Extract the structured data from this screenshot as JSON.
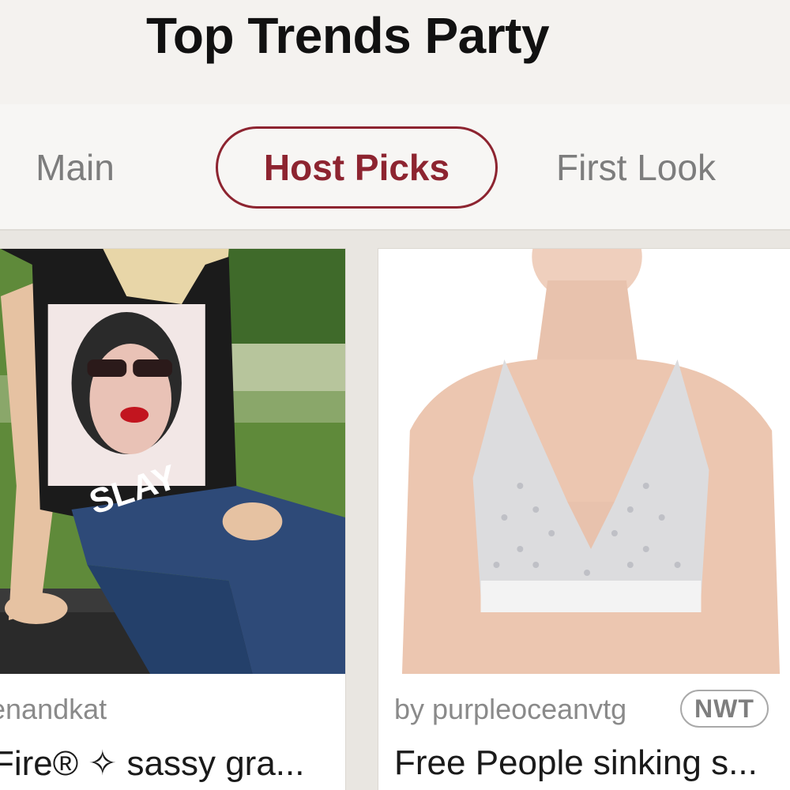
{
  "header": {
    "title": "Top Trends Party"
  },
  "tabs": [
    {
      "label": "Main",
      "active": false
    },
    {
      "label": "Host Picks",
      "active": true
    },
    {
      "label": "First Look",
      "active": false
    }
  ],
  "colors": {
    "accent": "#8d2430",
    "muted_text": "#7d7d7d",
    "background": "#eceae6"
  },
  "listings": [
    {
      "seller": "enandkat",
      "title": "Fire® ✧ sassy gra...",
      "shirt_text": "SLAY"
    },
    {
      "seller": "by purpleoceanvtg",
      "badge": "NWT",
      "title": "Free People sinking s..."
    }
  ]
}
